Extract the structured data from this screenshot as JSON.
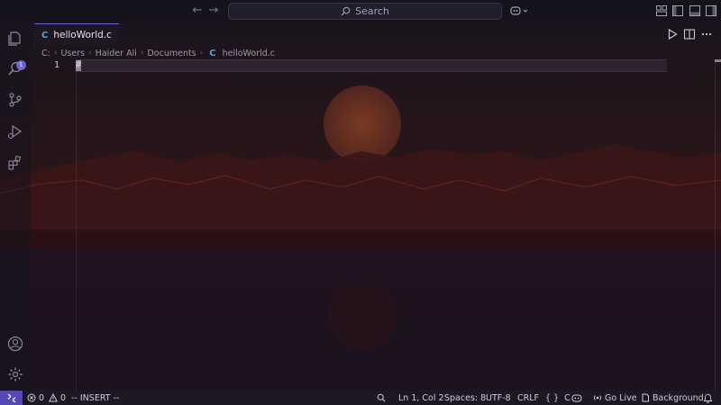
{
  "titlebar": {
    "search_label": "Search"
  },
  "activity_bar": {
    "explorer_badge": "1"
  },
  "tabs": [
    {
      "icon": "C",
      "label": "helloWorld.c",
      "dirty": true
    }
  ],
  "breadcrumb": {
    "parts": [
      "C:",
      "Users",
      "Haider Ali",
      "Documents"
    ],
    "file_icon": "C",
    "file": "helloWorld.c"
  },
  "editor": {
    "lines": [
      {
        "number": "1",
        "text": "#"
      }
    ]
  },
  "statusbar": {
    "errors": "0",
    "warnings": "0",
    "mode": "-- INSERT --",
    "position": "Ln 1, Col 2",
    "spaces": "Spaces: 8",
    "encoding": "UTF-8",
    "eol": "CRLF",
    "language_braces": "{ }",
    "language": "C",
    "go_live": "Go Live",
    "background": "Background"
  },
  "colors": {
    "accent": "#6a5fd6",
    "remote_button": "#5448b8",
    "c_file_icon": "#5aa0dc",
    "moon": "#8a3a2a",
    "mountains": "#4a1a16"
  }
}
